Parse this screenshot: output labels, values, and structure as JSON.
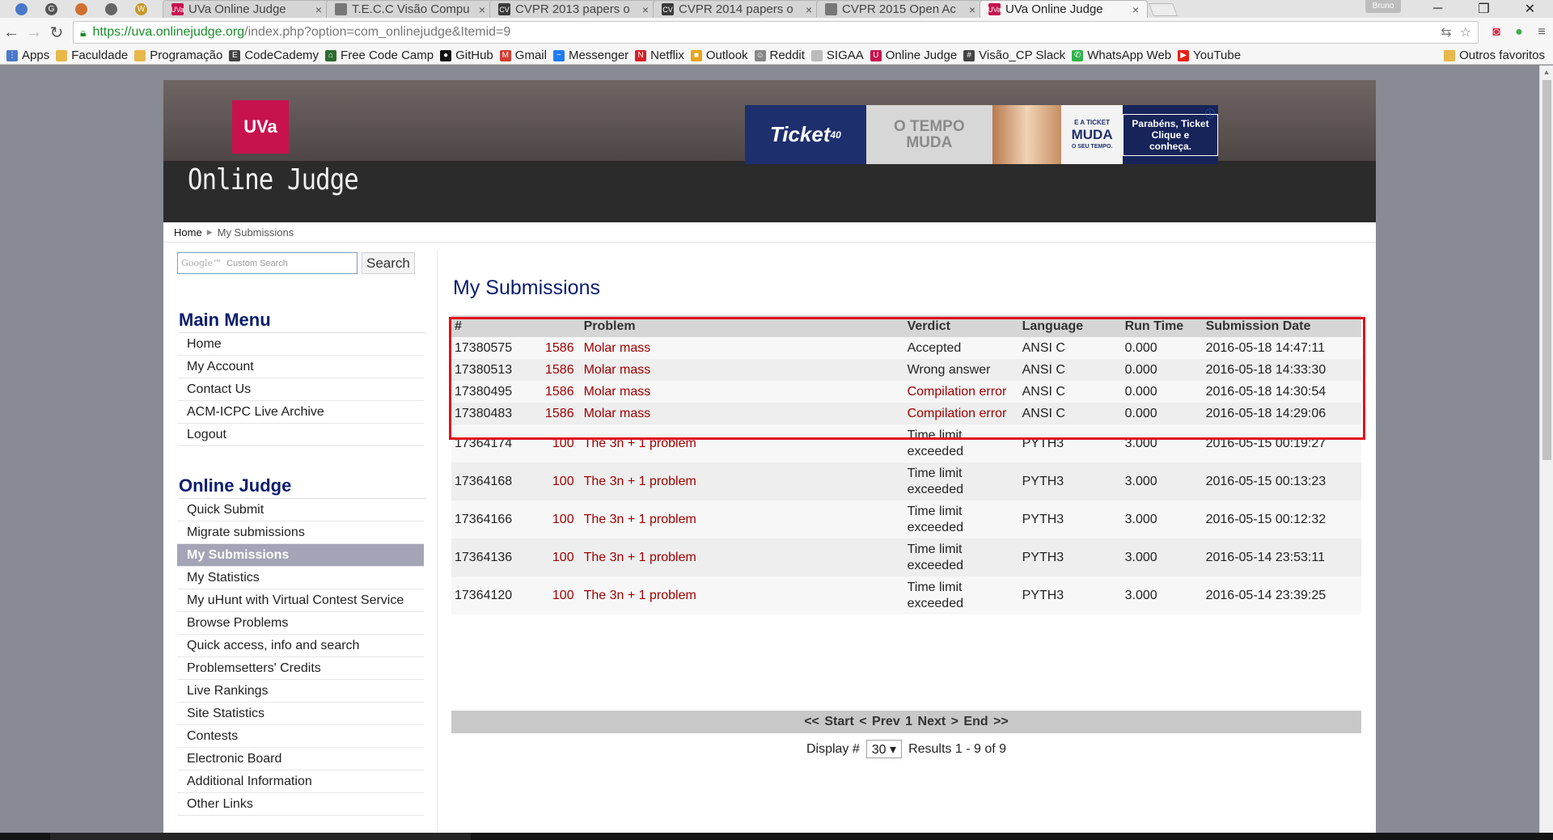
{
  "browser": {
    "pinned_tabs": [
      {
        "icon": "chrome-icon",
        "color": "#4a78c8",
        "glyph": ""
      },
      {
        "icon": "g-icon",
        "color": "#555555",
        "glyph": "G"
      },
      {
        "icon": "extension-icon",
        "color": "#d07030",
        "glyph": ""
      },
      {
        "icon": "link-icon",
        "color": "#666666",
        "glyph": ""
      },
      {
        "icon": "badge-icon",
        "color": "#c79a2a",
        "glyph": "W"
      }
    ],
    "tabs": [
      {
        "title": "UVa Online Judge",
        "favicon": "UVa",
        "favcolor": "#c8124e",
        "active": false
      },
      {
        "title": "T.E.C.C Visão Compu",
        "favicon": "",
        "favcolor": "#777777",
        "active": false
      },
      {
        "title": "CVPR 2013 papers o",
        "favicon": "CV",
        "favcolor": "#3a3a3a",
        "active": false
      },
      {
        "title": "CVPR 2014 papers o",
        "favicon": "CV",
        "favcolor": "#3a3a3a",
        "active": false
      },
      {
        "title": "CVPR 2015 Open Ac",
        "favicon": "",
        "favcolor": "#777777",
        "active": false
      },
      {
        "title": "UVa Online Judge",
        "favicon": "UVa",
        "favcolor": "#c8124e",
        "active": true
      }
    ],
    "profile_name": "Bruno",
    "url_host": "https://uva.onlinejudge.org",
    "url_path": "/index.php?option=com_onlinejudge&Itemid=9",
    "bookmarks": [
      {
        "label": "Apps",
        "icon": "apps-icon",
        "color": "#4a78c8",
        "glyph": "⋮"
      },
      {
        "label": "Faculdade",
        "icon": "folder-icon",
        "color": "#e8b84a",
        "glyph": ""
      },
      {
        "label": "Programação",
        "icon": "folder-icon",
        "color": "#e8b84a",
        "glyph": ""
      },
      {
        "label": "CodeCademy",
        "icon": "codecademy-icon",
        "color": "#444444",
        "glyph": "E"
      },
      {
        "label": "Free Code Camp",
        "icon": "freecodecamp-icon",
        "color": "#2e6b2e",
        "glyph": "⌂"
      },
      {
        "label": "GitHub",
        "icon": "github-icon",
        "color": "#111111",
        "glyph": "●"
      },
      {
        "label": "Gmail",
        "icon": "gmail-icon",
        "color": "#d33a2f",
        "glyph": "M"
      },
      {
        "label": "Messenger",
        "icon": "messenger-icon",
        "color": "#1f7cf2",
        "glyph": "~"
      },
      {
        "label": "Netflix",
        "icon": "netflix-icon",
        "color": "#d81f26",
        "glyph": "N"
      },
      {
        "label": "Outlook",
        "icon": "outlook-icon",
        "color": "#e8a41c",
        "glyph": "■"
      },
      {
        "label": "Reddit",
        "icon": "reddit-icon",
        "color": "#888888",
        "glyph": "☺"
      },
      {
        "label": "SIGAA",
        "icon": "page-icon",
        "color": "#bbbbbb",
        "glyph": ""
      },
      {
        "label": "Online Judge",
        "icon": "uva-icon",
        "color": "#c8124e",
        "glyph": "U"
      },
      {
        "label": "Visão_CP Slack",
        "icon": "slack-icon",
        "color": "#444444",
        "glyph": "#"
      },
      {
        "label": "WhatsApp Web",
        "icon": "whatsapp-icon",
        "color": "#2fb34a",
        "glyph": "✆"
      },
      {
        "label": "YouTube",
        "icon": "youtube-icon",
        "color": "#e62117",
        "glyph": "▶"
      }
    ],
    "bookmarks_other": "Outros favoritos"
  },
  "site": {
    "logo": "UVa",
    "title": "Online Judge",
    "ad": {
      "brand": "Ticket",
      "brand_sub": "40",
      "tagline_1": "O TEMPO",
      "tagline_2": "MUDA",
      "muda_small": "E A TICKET",
      "muda_big": "MUDA",
      "muda_sub": "O SEU TEMPO.",
      "cta": "Parabéns, Ticket Clique e conheça."
    },
    "breadcrumb": {
      "home": "Home",
      "current": "My Submissions"
    },
    "search": {
      "placeholder": "Custom Search",
      "google": "Google™",
      "button": "Search"
    },
    "main_menu": {
      "title": "Main Menu",
      "items": [
        "Home",
        "My Account",
        "Contact Us",
        "ACM-ICPC Live Archive",
        "Logout"
      ]
    },
    "oj_menu": {
      "title": "Online Judge",
      "items": [
        "Quick Submit",
        "Migrate submissions",
        "My Submissions",
        "My Statistics",
        "My uHunt with Virtual Contest Service",
        "Browse Problems",
        "Quick access, info and search",
        "Problemsetters' Credits",
        "Live Rankings",
        "Site Statistics",
        "Contests",
        "Electronic Board",
        "Additional Information",
        "Other Links"
      ],
      "active_index": 2
    },
    "page_title": "My Submissions",
    "table": {
      "headers": [
        "#",
        "Problem",
        "Verdict",
        "Language",
        "Run Time",
        "Submission Date"
      ],
      "rows": [
        {
          "id": "17380575",
          "num": "1586",
          "title": "Molar mass",
          "verdict": "Accepted",
          "lang": "ANSI C",
          "time": "0.000",
          "date": "2016-05-18 14:47:11",
          "tall": false,
          "ce": false
        },
        {
          "id": "17380513",
          "num": "1586",
          "title": "Molar mass",
          "verdict": "Wrong answer",
          "lang": "ANSI C",
          "time": "0.000",
          "date": "2016-05-18 14:33:30",
          "tall": false,
          "ce": false
        },
        {
          "id": "17380495",
          "num": "1586",
          "title": "Molar mass",
          "verdict": "Compilation error",
          "lang": "ANSI C",
          "time": "0.000",
          "date": "2016-05-18 14:30:54",
          "tall": false,
          "ce": true
        },
        {
          "id": "17380483",
          "num": "1586",
          "title": "Molar mass",
          "verdict": "Compilation error",
          "lang": "ANSI C",
          "time": "0.000",
          "date": "2016-05-18 14:29:06",
          "tall": false,
          "ce": true
        },
        {
          "id": "17364174",
          "num": "100",
          "title": "The 3n + 1 problem",
          "verdict": "Time limit exceeded",
          "lang": "PYTH3",
          "time": "3.000",
          "date": "2016-05-15 00:19:27",
          "tall": true,
          "ce": false
        },
        {
          "id": "17364168",
          "num": "100",
          "title": "The 3n + 1 problem",
          "verdict": "Time limit exceeded",
          "lang": "PYTH3",
          "time": "3.000",
          "date": "2016-05-15 00:13:23",
          "tall": true,
          "ce": false
        },
        {
          "id": "17364166",
          "num": "100",
          "title": "The 3n + 1 problem",
          "verdict": "Time limit exceeded",
          "lang": "PYTH3",
          "time": "3.000",
          "date": "2016-05-15 00:12:32",
          "tall": true,
          "ce": false
        },
        {
          "id": "17364136",
          "num": "100",
          "title": "The 3n + 1 problem",
          "verdict": "Time limit exceeded",
          "lang": "PYTH3",
          "time": "3.000",
          "date": "2016-05-14 23:53:11",
          "tall": true,
          "ce": false
        },
        {
          "id": "17364120",
          "num": "100",
          "title": "The 3n + 1 problem",
          "verdict": "Time limit exceeded",
          "lang": "PYTH3",
          "time": "3.000",
          "date": "2016-05-14 23:39:25",
          "tall": true,
          "ce": false
        }
      ]
    },
    "pager": "<< Start < Prev 1 Next > End >>",
    "display_label": "Display #",
    "display_value": "30 ▾",
    "results": "Results 1 - 9 of 9"
  }
}
